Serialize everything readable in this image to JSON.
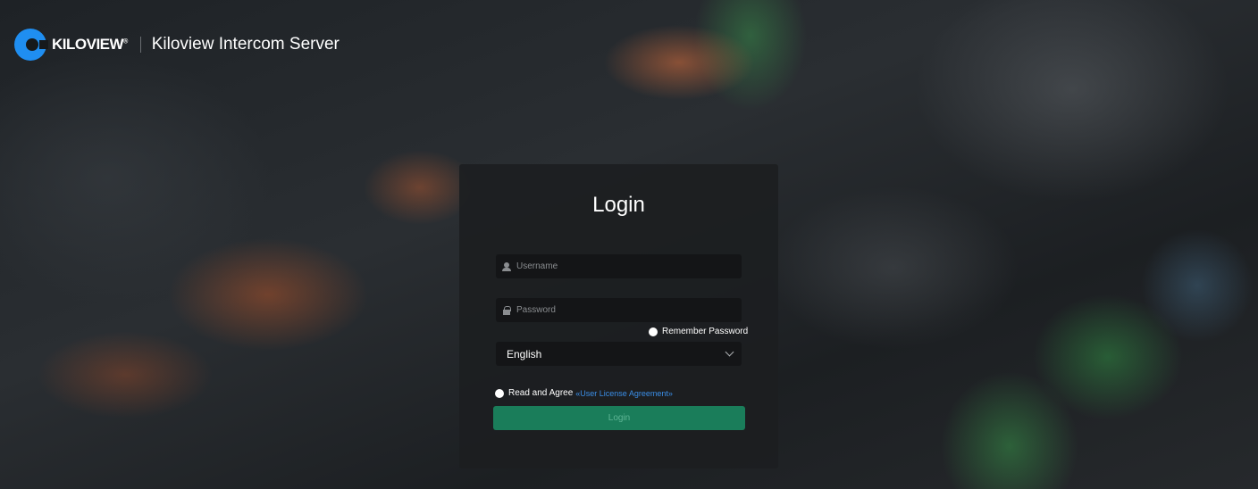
{
  "header": {
    "brand": "KILOVIEW",
    "brand_mark": "®",
    "app_title": "Kiloview Intercom Server"
  },
  "login": {
    "title": "Login",
    "username_placeholder": "Username",
    "password_placeholder": "Password",
    "remember_label": "Remember Password",
    "language_selected": "English",
    "agree_label": "Read and Agree",
    "agreement_link": "«User License Agreement»",
    "submit_label": "Login"
  },
  "colors": {
    "accent_green": "#1a7d5a",
    "link_blue": "#3a8ee6",
    "logo_blue": "#1f8ef1"
  },
  "icons": {
    "logo": "kiloview-logo-icon",
    "username": "user-icon",
    "password": "lock-icon",
    "language": "chevron-down-icon"
  }
}
